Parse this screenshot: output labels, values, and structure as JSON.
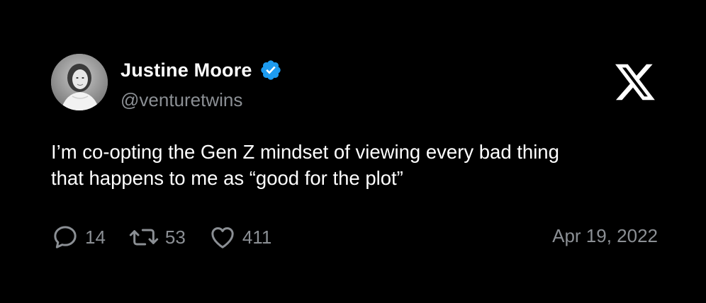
{
  "tweet": {
    "author": {
      "display_name": "Justine Moore",
      "handle": "@venturetwins",
      "verified": true,
      "avatar_icon": "profile-photo"
    },
    "text_line1": "I’m co-opting the Gen Z mindset of viewing every bad thing",
    "text_line2": "that happens to me as “good for the plot”",
    "metrics": {
      "replies": "14",
      "retweets": "53",
      "likes": "411"
    },
    "date": "Apr 19, 2022",
    "brand_icon": "x-logo-icon"
  },
  "colors": {
    "background": "#000000",
    "text_primary": "#ffffff",
    "text_secondary": "#8b8f94",
    "verified_blue": "#1d9bf0"
  }
}
